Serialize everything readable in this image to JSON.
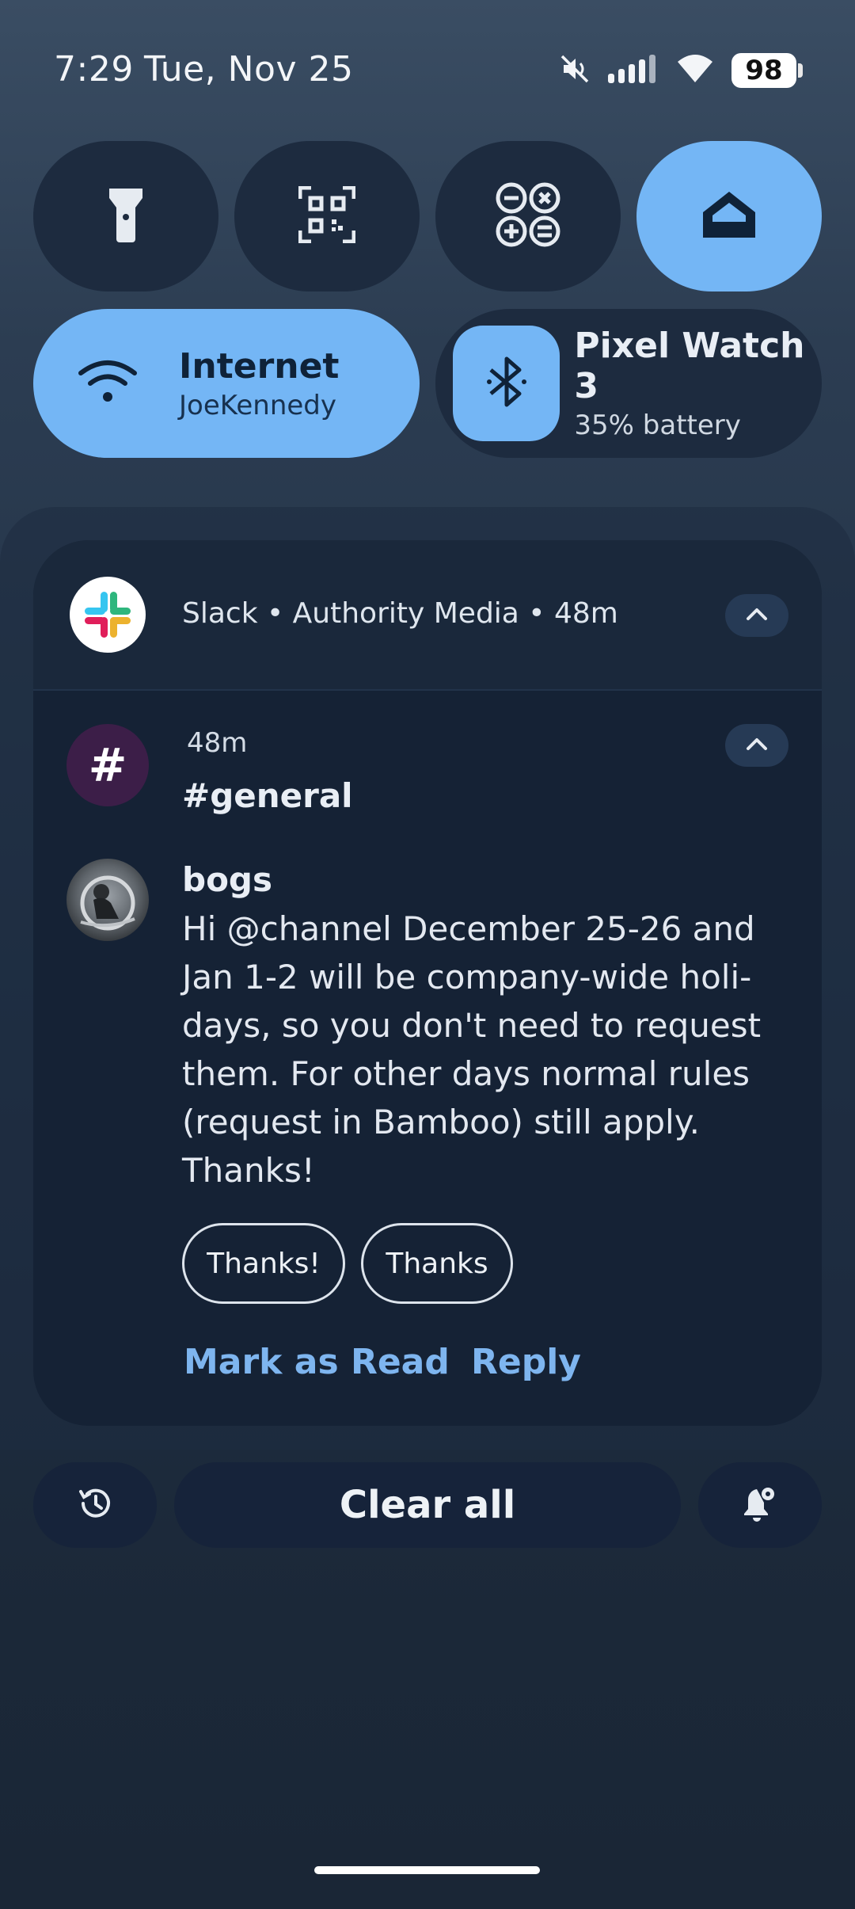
{
  "status_bar": {
    "time": "7:29",
    "date": "Tue, Nov 25",
    "battery": "98",
    "icons": [
      "mute-vibrate-icon",
      "cell-signal-icon",
      "wifi-icon",
      "battery-icon"
    ]
  },
  "quick_settings": {
    "tiles": [
      {
        "icon": "flashlight-icon",
        "active": false
      },
      {
        "icon": "qr-scanner-icon",
        "active": false
      },
      {
        "icon": "calculator-icon",
        "active": false
      },
      {
        "icon": "home-icon",
        "active": true
      }
    ],
    "internet": {
      "title": "Internet",
      "subtitle": "JoeKennedy",
      "icon": "wifi-icon",
      "active": true
    },
    "device": {
      "title": "Pixel Watch 3",
      "subtitle": "35% battery",
      "icon": "bluetooth-icon",
      "active": false
    }
  },
  "notification": {
    "header": "Slack • Authority Media • 48m",
    "time": "48m",
    "channel": "#general",
    "channel_avatar": "#",
    "sender": "bogs",
    "message_lines": [
      "Hi @channel December 25-26 and",
      "Jan 1-2 will be company-wide holi-",
      "days, so you don't need to request",
      "them. For other days normal rules",
      "(request in Bamboo) still apply.",
      "Thanks!"
    ],
    "smart_replies": [
      "Thanks!",
      "Thanks"
    ],
    "actions": {
      "mark_read": "Mark as Read",
      "reply": "Reply"
    }
  },
  "bottom_bar": {
    "history_icon": "history-icon",
    "clear_all": "Clear all",
    "settings_icon": "notification-settings-icon"
  },
  "colors": {
    "accent_tile": "#74b6f5",
    "dark_tile": "#1d2b3f",
    "card": "#152235",
    "action_text": "#7eb5ef"
  }
}
